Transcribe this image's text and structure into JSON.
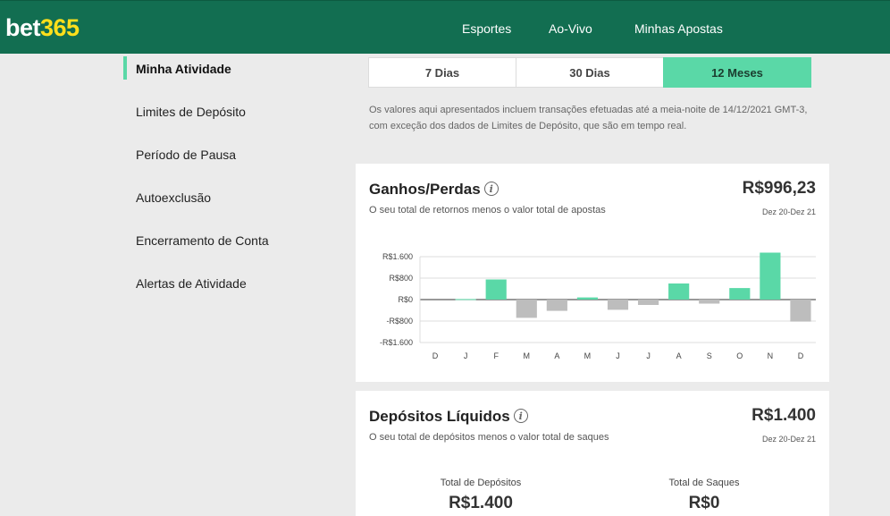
{
  "header": {
    "logo_main": "bet",
    "logo_accent": "365",
    "nav": [
      "Esportes",
      "Ao-Vivo",
      "Minhas Apostas"
    ],
    "colors": {
      "bg": "#126e51",
      "accent": "#ffdf1b"
    }
  },
  "sidebar": {
    "items": [
      {
        "label": "Minha Atividade",
        "active": true
      },
      {
        "label": "Limites de Depósito"
      },
      {
        "label": "Período de Pausa"
      },
      {
        "label": "Autoexclusão"
      },
      {
        "label": "Encerramento de Conta"
      },
      {
        "label": "Alertas de Atividade"
      }
    ],
    "accent": "#5ad8a7"
  },
  "tabs": [
    {
      "label": "7 Dias"
    },
    {
      "label": "30 Dias"
    },
    {
      "label": "12 Meses",
      "selected": true
    }
  ],
  "note": {
    "line1": "Os valores aqui apresentados incluem transações efetuadas até a meia-noite de 14/12/2021 GMT-3,",
    "line2": "com exceção dos dados de Limites de Depósito, que são em tempo real."
  },
  "winloss": {
    "title": "Ganhos/Perdas",
    "info_icon": "info-icon",
    "subtitle": "O seu total de retornos menos o valor total de apostas",
    "value": "R$996,23",
    "range": "Dez 20-Dez 21"
  },
  "chart_data": {
    "type": "bar",
    "categories": [
      "D",
      "J",
      "F",
      "M",
      "A",
      "M",
      "J",
      "J",
      "A",
      "S",
      "O",
      "N",
      "D"
    ],
    "values": [
      0,
      20,
      750,
      -680,
      -420,
      80,
      -380,
      -200,
      600,
      -150,
      430,
      1750,
      -820
    ],
    "yticks": [
      "R$1.600",
      "R$800",
      "R$0",
      "-R$800",
      "-R$1.600"
    ],
    "ylim": [
      -1600,
      1600
    ],
    "colors": {
      "positive": "#5ad8a7",
      "negative": "#bdbdbd"
    },
    "grid": true
  },
  "deposits": {
    "title": "Depósitos Líquidos",
    "info_icon": "info-icon",
    "subtitle": "O seu total de depósitos menos o valor total de saques",
    "value": "R$1.400",
    "range": "Dez 20-Dez 21",
    "total_deposits_label": "Total de Depósitos",
    "total_deposits_value": "R$1.400",
    "total_withdrawals_label": "Total de Saques",
    "total_withdrawals_value": "R$0"
  }
}
